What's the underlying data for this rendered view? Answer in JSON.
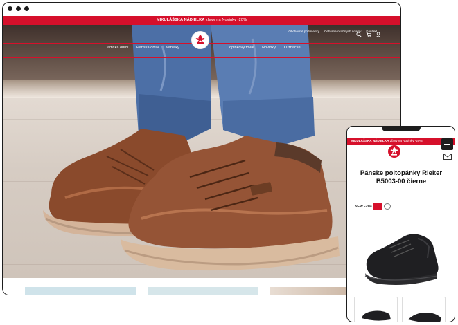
{
  "desktop": {
    "promo": {
      "bold": "MIKULÁŠSKA NÁDIELKA",
      "text": " zľavy na Novinky -20%"
    },
    "utility_links": [
      "Obchodné podmienky",
      "Ochrana osobných údajov",
      "Kontakt"
    ],
    "icons": [
      "search-icon",
      "cart-icon",
      "user-icon"
    ],
    "nav": [
      "Dámska obuv",
      "Pánska obuv",
      "Kabelky",
      "Doplnkový tovar",
      "Novinky",
      "O značke"
    ],
    "logo_text": "rieker"
  },
  "mobile": {
    "promo": {
      "bold": "MIKULÁŠSKA NÁDIELKA",
      "text": " zľavy na Novinky -20%"
    },
    "product_title": "Pánske poltopánky Rieker B5003-00 čierne",
    "badge_new": "NEW",
    "badge_discount": "-20",
    "badge_percent": "%",
    "icons": [
      "menu-icon",
      "mail-icon"
    ]
  },
  "colors": {
    "brand_red": "#d6102b",
    "frame": "#1d1d1d"
  }
}
